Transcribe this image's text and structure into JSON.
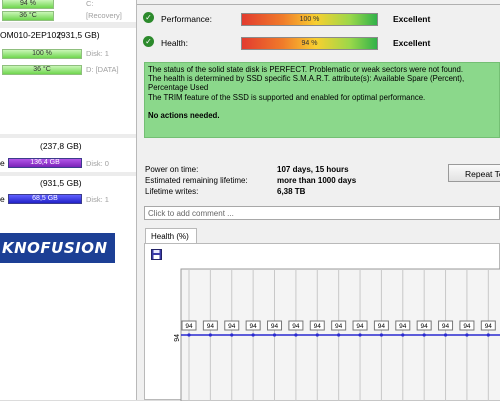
{
  "left_panel": {
    "rows": [
      {
        "pct": "94 %",
        "drive": "C:",
        "kind": "pct"
      },
      {
        "temp": "36 °C",
        "drive": "[Recovery]",
        "kind": "temp"
      }
    ],
    "disk2": {
      "name": "OM010-2EP102",
      "size": "(931,5 GB)",
      "health": "100 %",
      "health_label": "Disk: 1",
      "temp": "36 °C",
      "temp_label": "D: [DATA]"
    },
    "disk3": {
      "size": "(237,8 GB)",
      "used": "136,4 GB",
      "label": "Disk: 0",
      "prefix": "e"
    },
    "disk4": {
      "size": "(931,5 GB)",
      "used": "68,5 GB",
      "label": "Disk: 1",
      "prefix": "e"
    },
    "logo": "KNOFUSION"
  },
  "status": {
    "performance": {
      "label": "Performance:",
      "value": "100 %",
      "verdict": "Excellent"
    },
    "health": {
      "label": "Health:",
      "value": "94 %",
      "verdict": "Excellent"
    }
  },
  "info": {
    "line1": "The status of the solid state disk is PERFECT. Problematic or weak sectors were not found.",
    "line2": "The health is determined by SSD specific S.M.A.R.T. attribute(s):  Available Spare (Percent),",
    "line3": "Percentage Used",
    "line4": "The TRIM feature of the SSD is supported and enabled for optimal performance.",
    "action": "No actions needed."
  },
  "stats": {
    "power_on_label": "Power on time:",
    "power_on_value": "107 days, 15 hours",
    "lifetime_label": "Estimated remaining lifetime:",
    "lifetime_value": "more than 1000 days",
    "writes_label": "Lifetime writes:",
    "writes_value": "6,38 TB"
  },
  "repeat_button": "Repeat Te",
  "comment_placeholder": "Click to add comment ...",
  "health_tab": "Health (%)",
  "chart_data": {
    "type": "line",
    "title": "",
    "ylabel": "",
    "y_axis_label": "94",
    "series": [
      {
        "name": "",
        "values": [
          94,
          94,
          94,
          94,
          94,
          94,
          94,
          94,
          94,
          94,
          94,
          94,
          94,
          94,
          94
        ]
      }
    ],
    "color": "#2a2ad0",
    "grid": true
  },
  "colors": {
    "info_bg": "#8bd88b",
    "health_line": "#2a2ad0",
    "logo_bg": "#1c3f95"
  }
}
